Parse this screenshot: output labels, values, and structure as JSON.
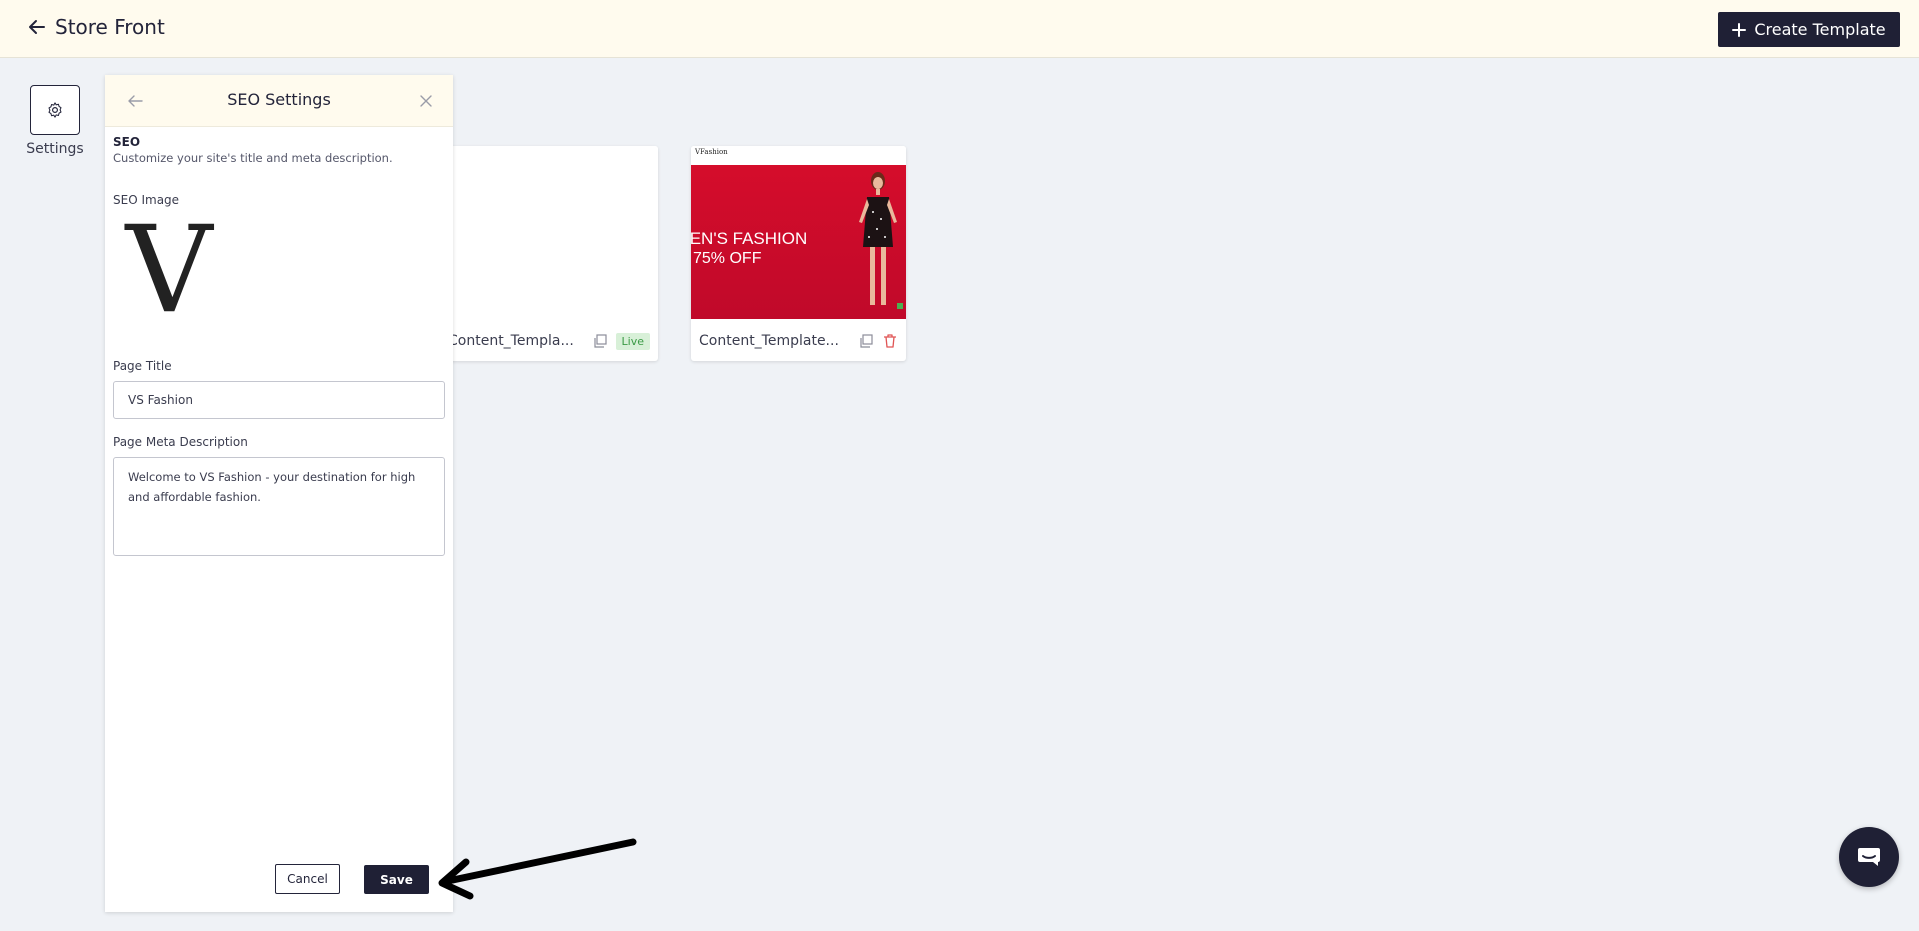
{
  "topbar": {
    "title": "Store Front",
    "create_label": "Create Template"
  },
  "sidebar": {
    "settings_label": "Settings"
  },
  "templates": [
    {
      "name": "Content_Templa...",
      "badge": "Live"
    },
    {
      "name": "Content_Template...",
      "banner_line1": "IEN'S FASHION",
      "banner_line2": "75% OFF",
      "logo": "VFashion"
    }
  ],
  "panel": {
    "title": "SEO Settings",
    "section_title": "SEO",
    "section_desc": "Customize your site's title and meta description.",
    "image_label": "SEO Image",
    "image_letter": "V",
    "page_title_label": "Page Title",
    "page_title_value": "VS Fashion",
    "meta_label": "Page Meta Description",
    "meta_value": "Welcome to VS Fashion - your destination for high and affordable fashion.",
    "cancel_label": "Cancel",
    "save_label": "Save"
  },
  "colors": {
    "topbar_bg": "#fffbee",
    "primary": "#1f2035",
    "page_bg": "#eff2f6",
    "banner_red": "#d50d2b",
    "live_green": "#3a9a45",
    "trash_red": "#e05555"
  },
  "icons": [
    "arrow-left-icon",
    "plus-icon",
    "gear-icon",
    "copy-icon",
    "trash-icon",
    "close-icon",
    "chat-icon"
  ]
}
